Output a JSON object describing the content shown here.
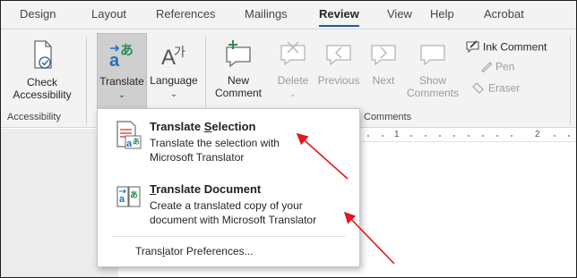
{
  "tabs": [
    "Design",
    "Layout",
    "References",
    "Mailings",
    "Review",
    "View",
    "Help",
    "Acrobat"
  ],
  "active_tab": "Review",
  "ribbon": {
    "accessibility": {
      "check_label_1": "Check",
      "check_label_2": "Accessibility",
      "group_label": "Accessibility"
    },
    "translate_label": "Translate",
    "language_label": "Language",
    "comments": {
      "new_label_1": "New",
      "new_label_2": "Comment",
      "delete_label": "Delete",
      "previous_label": "Previous",
      "next_label": "Next",
      "show_label_1": "Show",
      "show_label_2": "Comments",
      "group_label": "Comments"
    },
    "ink": {
      "ink_comment": "Ink Comment",
      "pen": "Pen",
      "eraser": "Eraser"
    }
  },
  "ruler": {
    "marks": [
      "1",
      "2"
    ]
  },
  "menu": {
    "item1": {
      "title": "Translate Selection",
      "title_prefix": "Translate ",
      "title_accel": "S",
      "title_rest": "election",
      "desc1": "Translate the selection with",
      "desc2": "Microsoft Translator"
    },
    "item2": {
      "title": "Translate Document",
      "title_accel": "T",
      "title_rest": "ranslate Document",
      "desc1": "Create a translated copy of your",
      "desc2": "document with Microsoft Translator"
    },
    "preferences": {
      "label": "Translator Preferences...",
      "prefix": "Trans",
      "accel": "l",
      "rest": "ator Preferences..."
    }
  },
  "colors": {
    "accent": "#2b579a",
    "arrow": "#e3161b",
    "translate_green": "#2e8b57",
    "translate_blue": "#1f6fbf"
  }
}
